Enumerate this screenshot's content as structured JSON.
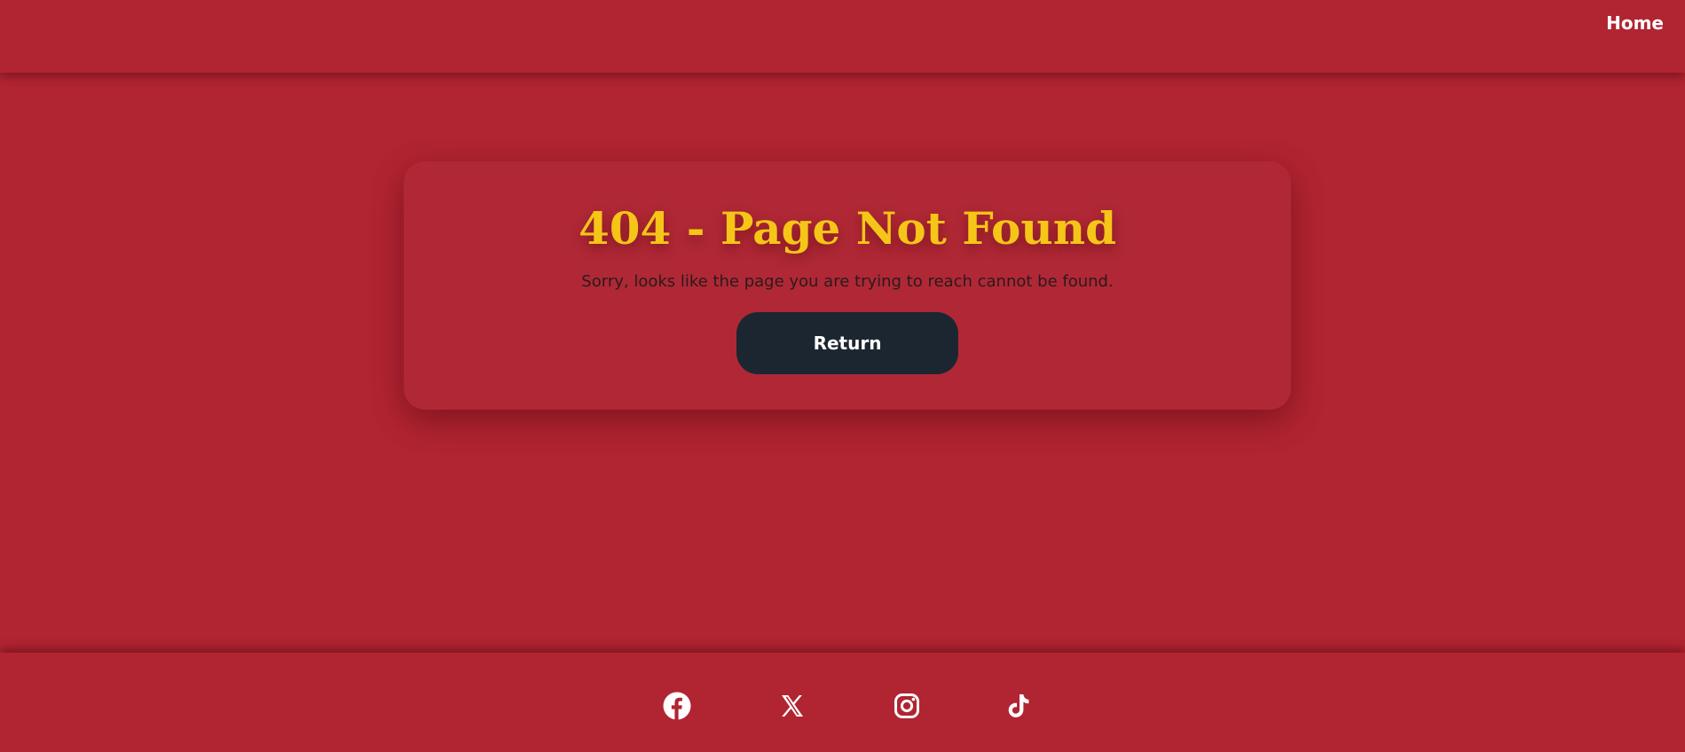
{
  "header": {
    "nav_home_label": "Home"
  },
  "card": {
    "title": "404 - Page Not Found",
    "message": "Sorry, looks like the page you are trying to reach cannot be found.",
    "return_label": "Return"
  },
  "footer": {
    "social_icons": [
      "facebook-icon",
      "x-icon",
      "instagram-icon",
      "tiktok-icon"
    ]
  },
  "colors": {
    "background": "#b12431",
    "title": "#f5c518",
    "button": "#1c2631",
    "text_light": "#ffffff",
    "text_dark": "#2a1a1d"
  }
}
